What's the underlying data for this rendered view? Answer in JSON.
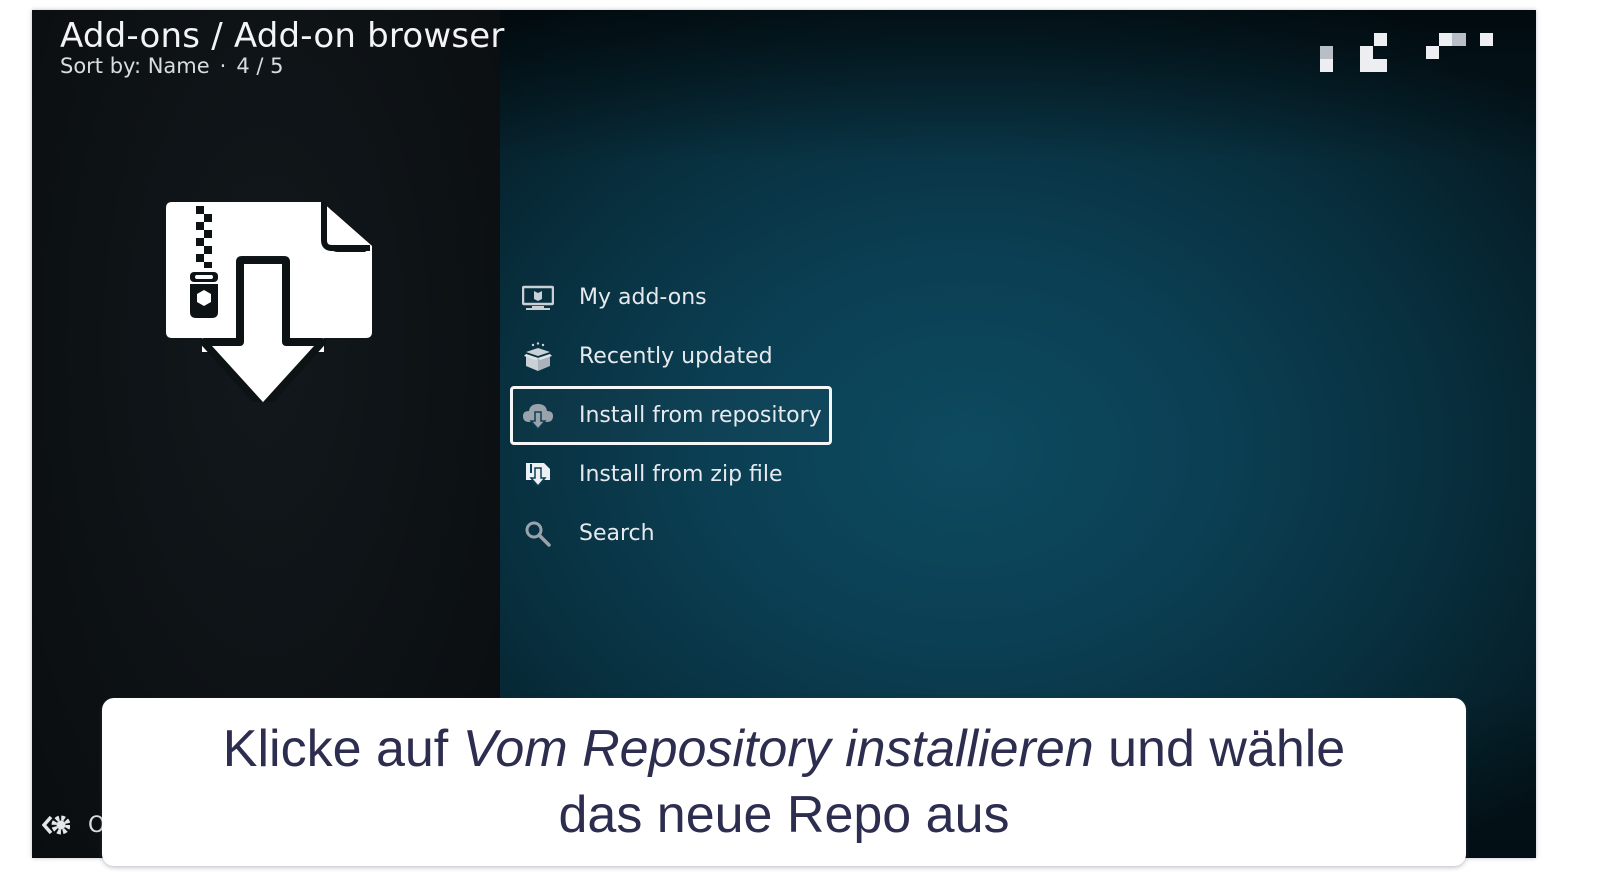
{
  "header": {
    "title": "Add-ons / Add-on browser",
    "sort_label": "Sort by: Name",
    "separator": "·",
    "position": "4 / 5"
  },
  "preview": {
    "icon": "zip-file-download-icon"
  },
  "menu": {
    "items": [
      {
        "label": "My add-ons",
        "icon": "monitor-addon-icon",
        "focused": false
      },
      {
        "label": "Recently updated",
        "icon": "open-box-icon",
        "focused": false
      },
      {
        "label": "Install from repository",
        "icon": "cloud-download-icon",
        "focused": true
      },
      {
        "label": "Install from zip file",
        "icon": "zip-download-icon",
        "focused": false
      },
      {
        "label": "Search",
        "icon": "search-icon",
        "focused": false
      }
    ]
  },
  "footer": {
    "icon": "addon-settings-icon",
    "text": "O"
  },
  "caption": {
    "line1_prefix": "Klicke auf ",
    "line1_emph": "Vom Repository installieren",
    "line1_suffix": " und wähle",
    "line2": "das neue Repo aus"
  },
  "colors": {
    "caption_text": "#2c2d4f",
    "accent_bg": "#0b3f53",
    "focus_border": "#f4f6f8"
  }
}
